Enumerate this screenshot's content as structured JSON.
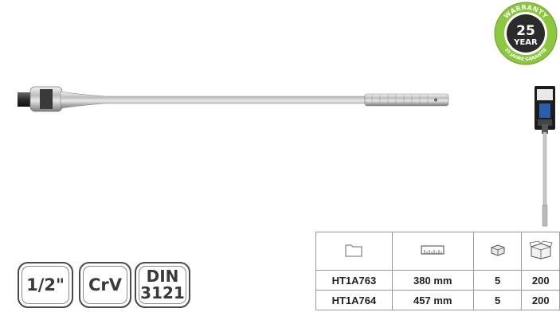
{
  "warranty_seal": {
    "top_text": "WARRANTY",
    "number": "25",
    "unit": "YEAR",
    "bottom_text": "25 JAHRE GARANTIE",
    "colors": {
      "ring": "#8dc63f",
      "center": "#2b2b2b",
      "text": "#ffffff"
    }
  },
  "badges": [
    {
      "line1": "1/2\""
    },
    {
      "line1": "CrV"
    },
    {
      "line1": "DIN",
      "line2": "3121"
    }
  ],
  "table": {
    "header_icons": [
      "folder-icon",
      "ruler-icon",
      "box-icon",
      "carton-icon"
    ],
    "rows": [
      {
        "code": "HT1A763",
        "length": "380 mm",
        "pack": "5",
        "carton": "200"
      },
      {
        "code": "HT1A764",
        "length": "457 mm",
        "pack": "5",
        "carton": "200"
      }
    ]
  }
}
